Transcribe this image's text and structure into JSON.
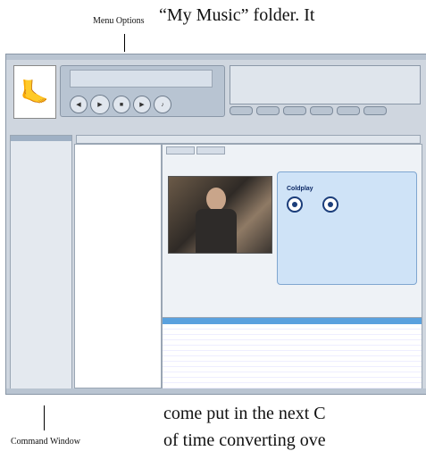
{
  "document": {
    "top_text": "“My Music” folder. It",
    "bottom_line_1": "come put in the next C",
    "bottom_line_2": "of time converting ove"
  },
  "callouts": {
    "menu_options": "Menu Options",
    "command_window": "Command Window"
  },
  "app": {
    "artist_name": "Coldplay"
  }
}
